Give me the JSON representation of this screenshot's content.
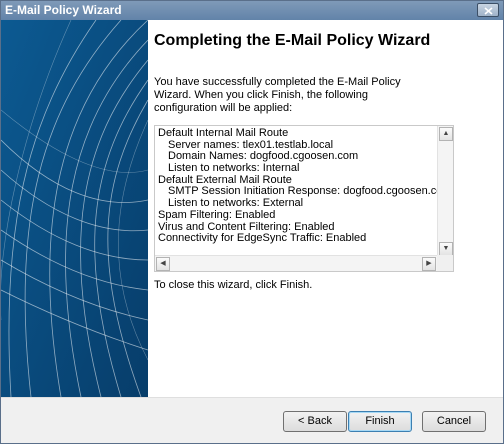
{
  "window": {
    "title": "E-Mail Policy Wizard"
  },
  "page": {
    "heading": "Completing the E-Mail Policy Wizard",
    "intro": "You have successfully completed the E-Mail Policy Wizard. When you click Finish, the following configuration will be applied:",
    "summary_lines": [
      {
        "text": "Default Internal Mail Route",
        "indent": 0
      },
      {
        "text": "Server names: tlex01.testlab.local",
        "indent": 1
      },
      {
        "text": "Domain Names: dogfood.cgoosen.com",
        "indent": 1
      },
      {
        "text": "Listen to networks: Internal",
        "indent": 1
      },
      {
        "text": "Default External Mail Route",
        "indent": 0
      },
      {
        "text": "SMTP Session Initiation Response: dogfood.cgoosen.com",
        "indent": 1
      },
      {
        "text": "Listen to networks: External",
        "indent": 1
      },
      {
        "text": "Spam Filtering: Enabled",
        "indent": 0
      },
      {
        "text": "Virus and Content Filtering: Enabled",
        "indent": 0
      },
      {
        "text": "Connectivity for EdgeSync Traffic: Enabled",
        "indent": 0
      }
    ],
    "closing": "To close this wizard, click Finish."
  },
  "buttons": {
    "back": "< Back",
    "finish": "Finish",
    "cancel": "Cancel"
  },
  "colors": {
    "banner": "#0d4f84",
    "titlebar": "#6a8ab0"
  }
}
